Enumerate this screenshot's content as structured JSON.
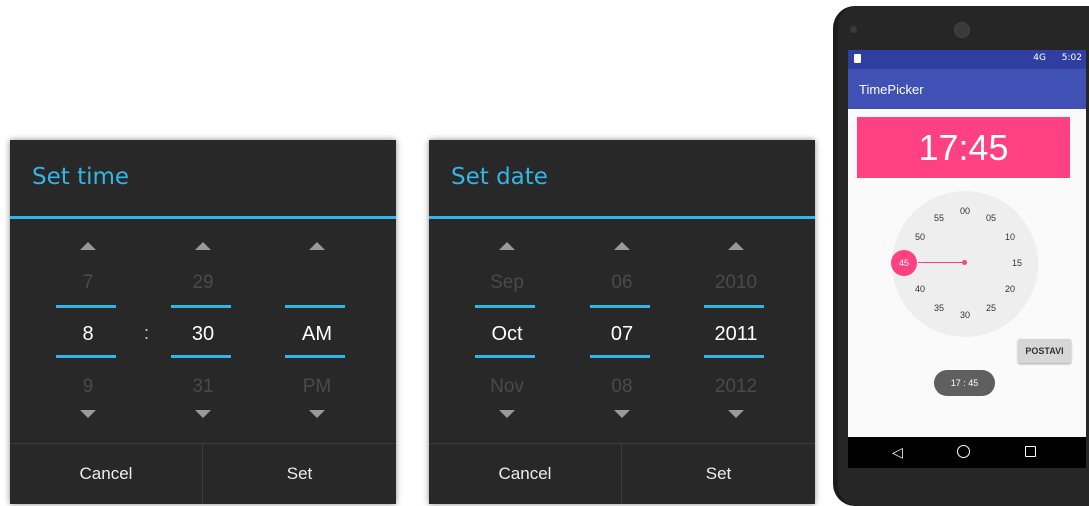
{
  "time_dialog": {
    "title": "Set time",
    "columns": [
      {
        "prev": "7",
        "current": "8",
        "next": "9"
      },
      {
        "prev": "29",
        "current": "30",
        "next": "31"
      },
      {
        "prev": "",
        "current": "AM",
        "next": "PM"
      }
    ],
    "separator": ":",
    "cancel_label": "Cancel",
    "set_label": "Set"
  },
  "date_dialog": {
    "title": "Set date",
    "columns": [
      {
        "prev": "Sep",
        "current": "Oct",
        "next": "Nov"
      },
      {
        "prev": "06",
        "current": "07",
        "next": "08"
      },
      {
        "prev": "2010",
        "current": "2011",
        "next": "2012"
      }
    ],
    "cancel_label": "Cancel",
    "set_label": "Set"
  },
  "phone": {
    "status_time": "5:02",
    "status_signal": "4G",
    "app_title": "TimePicker",
    "clock_display": "17:45",
    "dial_numbers": [
      "00",
      "05",
      "10",
      "15",
      "20",
      "25",
      "30",
      "35",
      "40",
      "45",
      "50",
      "55"
    ],
    "selected_minute": "45",
    "postavi_label": "POSTAVI",
    "toast_text": "17 : 45",
    "nav_back_icon": "triangle-back-icon",
    "nav_home_icon": "circle-home-icon",
    "nav_recent_icon": "square-recents-icon"
  },
  "colors": {
    "holo_blue": "#33b5e5",
    "dialog_bg": "#282828",
    "accent_pink": "#ff4081",
    "primary": "#3f51b5",
    "primary_dark": "#303f9f"
  }
}
